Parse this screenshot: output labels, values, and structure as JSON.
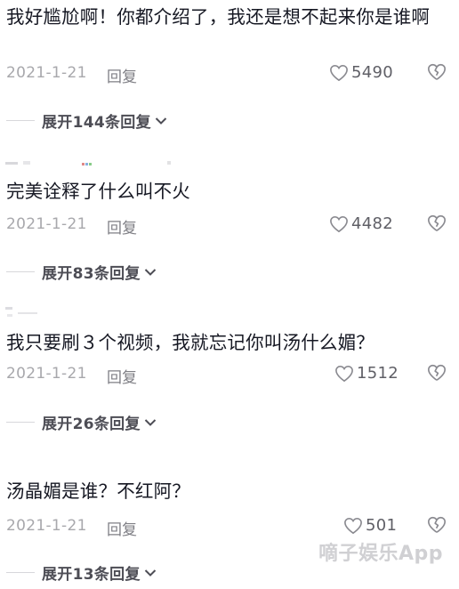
{
  "comments": [
    {
      "text": "我好尴尬啊！你都介绍了，我还是想不起来你是谁啊",
      "date": "2021-1-21",
      "reply_label": "回复",
      "likes": "5490",
      "expand_label": "展开144条回复"
    },
    {
      "text": "完美诠释了什么叫不火",
      "date": "2021-1-21",
      "reply_label": "回复",
      "likes": "4482",
      "expand_label": "展开83条回复"
    },
    {
      "text": "我只要刷３个视频，我就忘记你叫汤什么媚？",
      "date": "2021-1-21",
      "reply_label": "回复",
      "likes": "1512",
      "expand_label": "展开26条回复"
    },
    {
      "text": "汤晶媚是谁？不红阿？",
      "date": "2021-1-21",
      "reply_label": "回复",
      "likes": "501",
      "expand_label": "展开13条回复"
    }
  ],
  "watermark": "嘀子娱乐App",
  "icons": {
    "like": "heart-outline-icon",
    "dislike": "broken-heart-icon",
    "expand": "chevron-down-icon"
  },
  "colors": {
    "text": "#161823",
    "meta": "#a8a8ac",
    "icon": "#8a8a90"
  }
}
